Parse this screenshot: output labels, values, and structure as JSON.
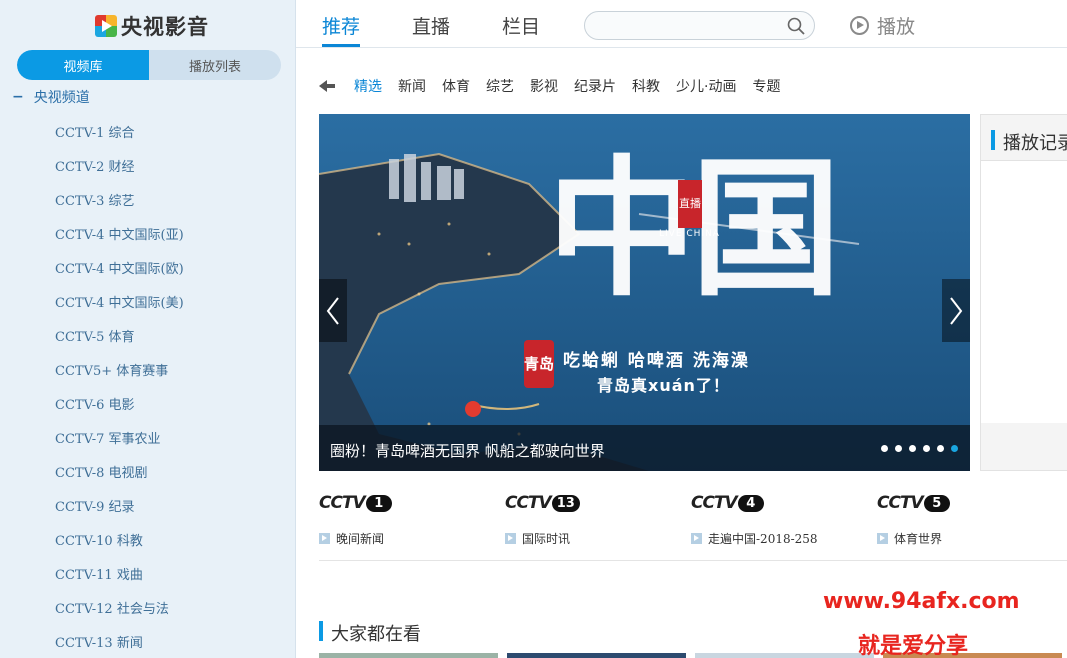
{
  "app": {
    "logo_text": "央视影音"
  },
  "sidebar": {
    "tabs": [
      {
        "label": "视频库",
        "active": true
      },
      {
        "label": "播放列表",
        "active": false
      }
    ],
    "group_label": "央视频道",
    "channels": [
      "CCTV-1 综合",
      "CCTV-2 财经",
      "CCTV-3 综艺",
      "CCTV-4 中文国际(亚)",
      "CCTV-4 中文国际(欧)",
      "CCTV-4 中文国际(美)",
      "CCTV-5 体育",
      "CCTV5+ 体育赛事",
      "CCTV-6 电影",
      "CCTV-7 军事农业",
      "CCTV-8 电视剧",
      "CCTV-9 纪录",
      "CCTV-10 科教",
      "CCTV-11 戏曲",
      "CCTV-12 社会与法",
      "CCTV-13 新闻"
    ]
  },
  "topnav": {
    "tabs": [
      {
        "label": "推荐",
        "active": true
      },
      {
        "label": "直播"
      },
      {
        "label": "栏目"
      }
    ],
    "search_placeholder": "",
    "play_label": "播放"
  },
  "categories": [
    "精选",
    "新闻",
    "体育",
    "综艺",
    "影视",
    "纪录片",
    "科教",
    "少儿·动画",
    "专题"
  ],
  "banner": {
    "big_char": "中国",
    "seal_text": "直播",
    "seal_sub": "LIVE CHINA",
    "city_seal": "青岛",
    "slogan_line1": "吃蛤蜊  哈啤酒  洗海澡",
    "slogan_line2": "青岛真xuán了！",
    "caption": "圈粉！青岛啤酒无国界 帆船之都驶向世界",
    "dots_total": 6,
    "active_dot": 5
  },
  "history": {
    "title": "播放记录"
  },
  "channel_row": [
    {
      "logo": "CCTV",
      "number": "1",
      "program": "晚间新闻"
    },
    {
      "logo": "CCTV",
      "number": "13",
      "program": "国际时讯"
    },
    {
      "logo": "CCTV",
      "number": "4",
      "program": "走遍中国-2018-258"
    },
    {
      "logo": "CCTV",
      "number": "5",
      "program": "体育世界"
    }
  ],
  "popular": {
    "title": "大家都在看"
  },
  "watermark": {
    "line1": "www.94afx.com",
    "line2": "就是爱分享"
  },
  "colors": {
    "accent": "#0b9ae4",
    "nav_active": "#0b86d6",
    "seal_red": "#c8252b",
    "watermark": "#e8251f"
  }
}
